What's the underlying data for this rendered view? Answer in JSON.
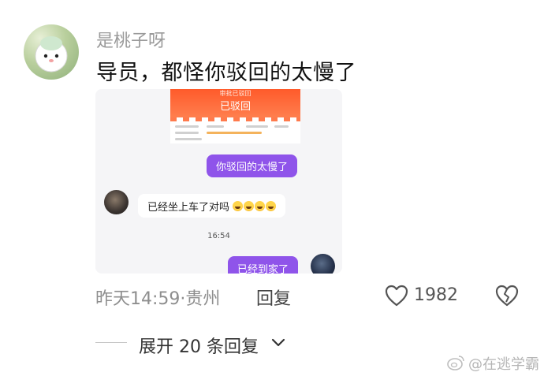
{
  "comment": {
    "username": "是桃子呀",
    "text": "导员，都怪你驳回的太慢了",
    "meta": "昨天14:59·贵州",
    "reply_label": "回复",
    "like_count": "1982"
  },
  "screenshot": {
    "header_small": "审批已驳回",
    "header_title": "已驳回",
    "bubble_sent_1": "你驳回的太慢了",
    "bubble_received_1": "已经坐上车了对吗",
    "time": "16:54",
    "bubble_sent_2": "已经到家了"
  },
  "footer": {
    "expand_label": "展开 20 条回复"
  },
  "watermark": {
    "text": "@在逃学霸"
  },
  "colors": {
    "bubble_purple": "#8f54ea",
    "header_orange": "#ff6b3d"
  }
}
